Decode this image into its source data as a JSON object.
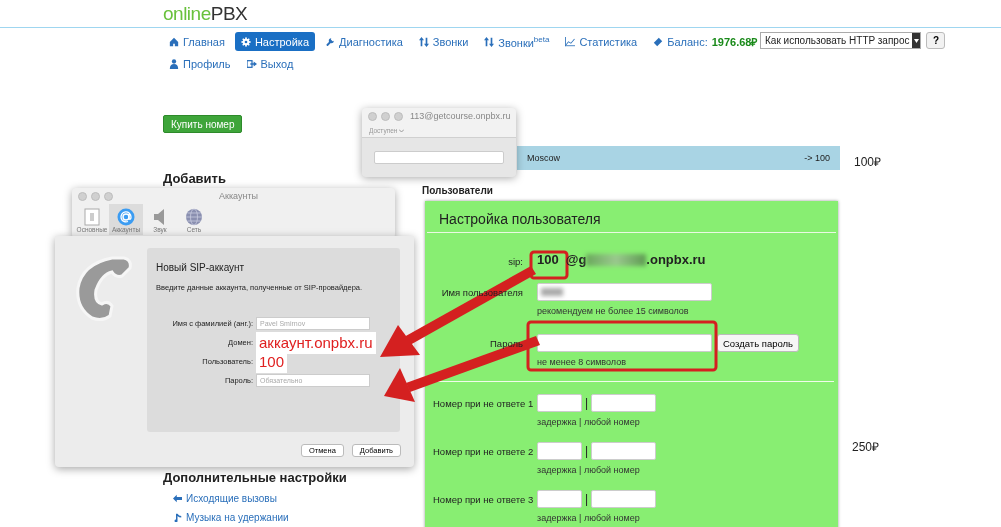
{
  "logo": {
    "brand_start": "online",
    "brand_end": "PBX"
  },
  "nav": {
    "rows": [
      [
        {
          "label": "Главная",
          "selected": false
        },
        {
          "label": "Настройка",
          "selected": true
        },
        {
          "label": "Диагностика",
          "selected": false
        },
        {
          "label": "Звонки",
          "selected": false
        },
        {
          "label": "Звонки$^{beta}$",
          "selected": false
        },
        {
          "label": "Статистика",
          "selected": false
        }
      ],
      [
        {
          "label": "Профиль",
          "selected": false
        },
        {
          "label": "Выход",
          "selected": false
        }
      ]
    ],
    "balance": {
      "label": "Баланс:",
      "value": "1976.68₽"
    }
  },
  "help": {
    "select": "Как использовать HTTP запрос",
    "button": "?"
  },
  "buy_button": "Купить номер",
  "add_heading": "Добавить",
  "extra": {
    "heading": "Дополнительные настройки",
    "links": [
      "Исходящие вызовы",
      "Музыка на удержании"
    ]
  },
  "number_row": {
    "name": "Moscow",
    "target": "-> 100",
    "price": "100₽"
  },
  "second_price": "250₽",
  "users_heading": "Пользователи",
  "user_settings": {
    "title": "Настройка пользователя",
    "sip_label": "sip:",
    "sip_number": "100",
    "sip_start": "@g",
    "sip_end": ".onpbx.ru",
    "username_label": "Имя пользователя",
    "username_hint": "рекомендуем не более 15 символов",
    "password_label": "Пароль",
    "password_button": "Создать пароль",
    "password_hint": "не менее 8 символов",
    "no_answer": [
      {
        "label": "Номер при не ответе 1",
        "separator": "|",
        "hint": "задержка | любой номер"
      },
      {
        "label": "Номер при не ответе 2",
        "separator": "|",
        "hint": "задержка | любой номер"
      },
      {
        "label": "Номер при не ответе 3",
        "separator": "|",
        "hint": "задержка | любой номер"
      }
    ]
  },
  "presence_window": {
    "title": "113@getcourse.onpbx.ru",
    "status": "Доступен"
  },
  "accounts_window": {
    "title": "Аккаунты",
    "tabs": [
      {
        "label": "Основные",
        "selected": false
      },
      {
        "label": "Аккаунты",
        "selected": true
      },
      {
        "label": "Звук",
        "selected": false
      },
      {
        "label": "Сеть",
        "selected": false
      }
    ],
    "sheet": {
      "title": "Новый SIP-аккаунт",
      "description": "Введите данные аккаунта, полученные от SIP-провайдера.",
      "fields": [
        {
          "label": "Имя с фамилией (анг.):",
          "kind": "placeholder",
          "text": "Pavel Smirnov"
        },
        {
          "label": "Домен:",
          "kind": "annotated",
          "text": "аккаунт.onpbx.ru"
        },
        {
          "label": "Пользователь:",
          "kind": "annotated",
          "text": "100"
        },
        {
          "label": "Пароль:",
          "kind": "placeholder",
          "text": "Обязательно"
        }
      ],
      "buttons": [
        "Отмена",
        "Добавить"
      ]
    }
  }
}
